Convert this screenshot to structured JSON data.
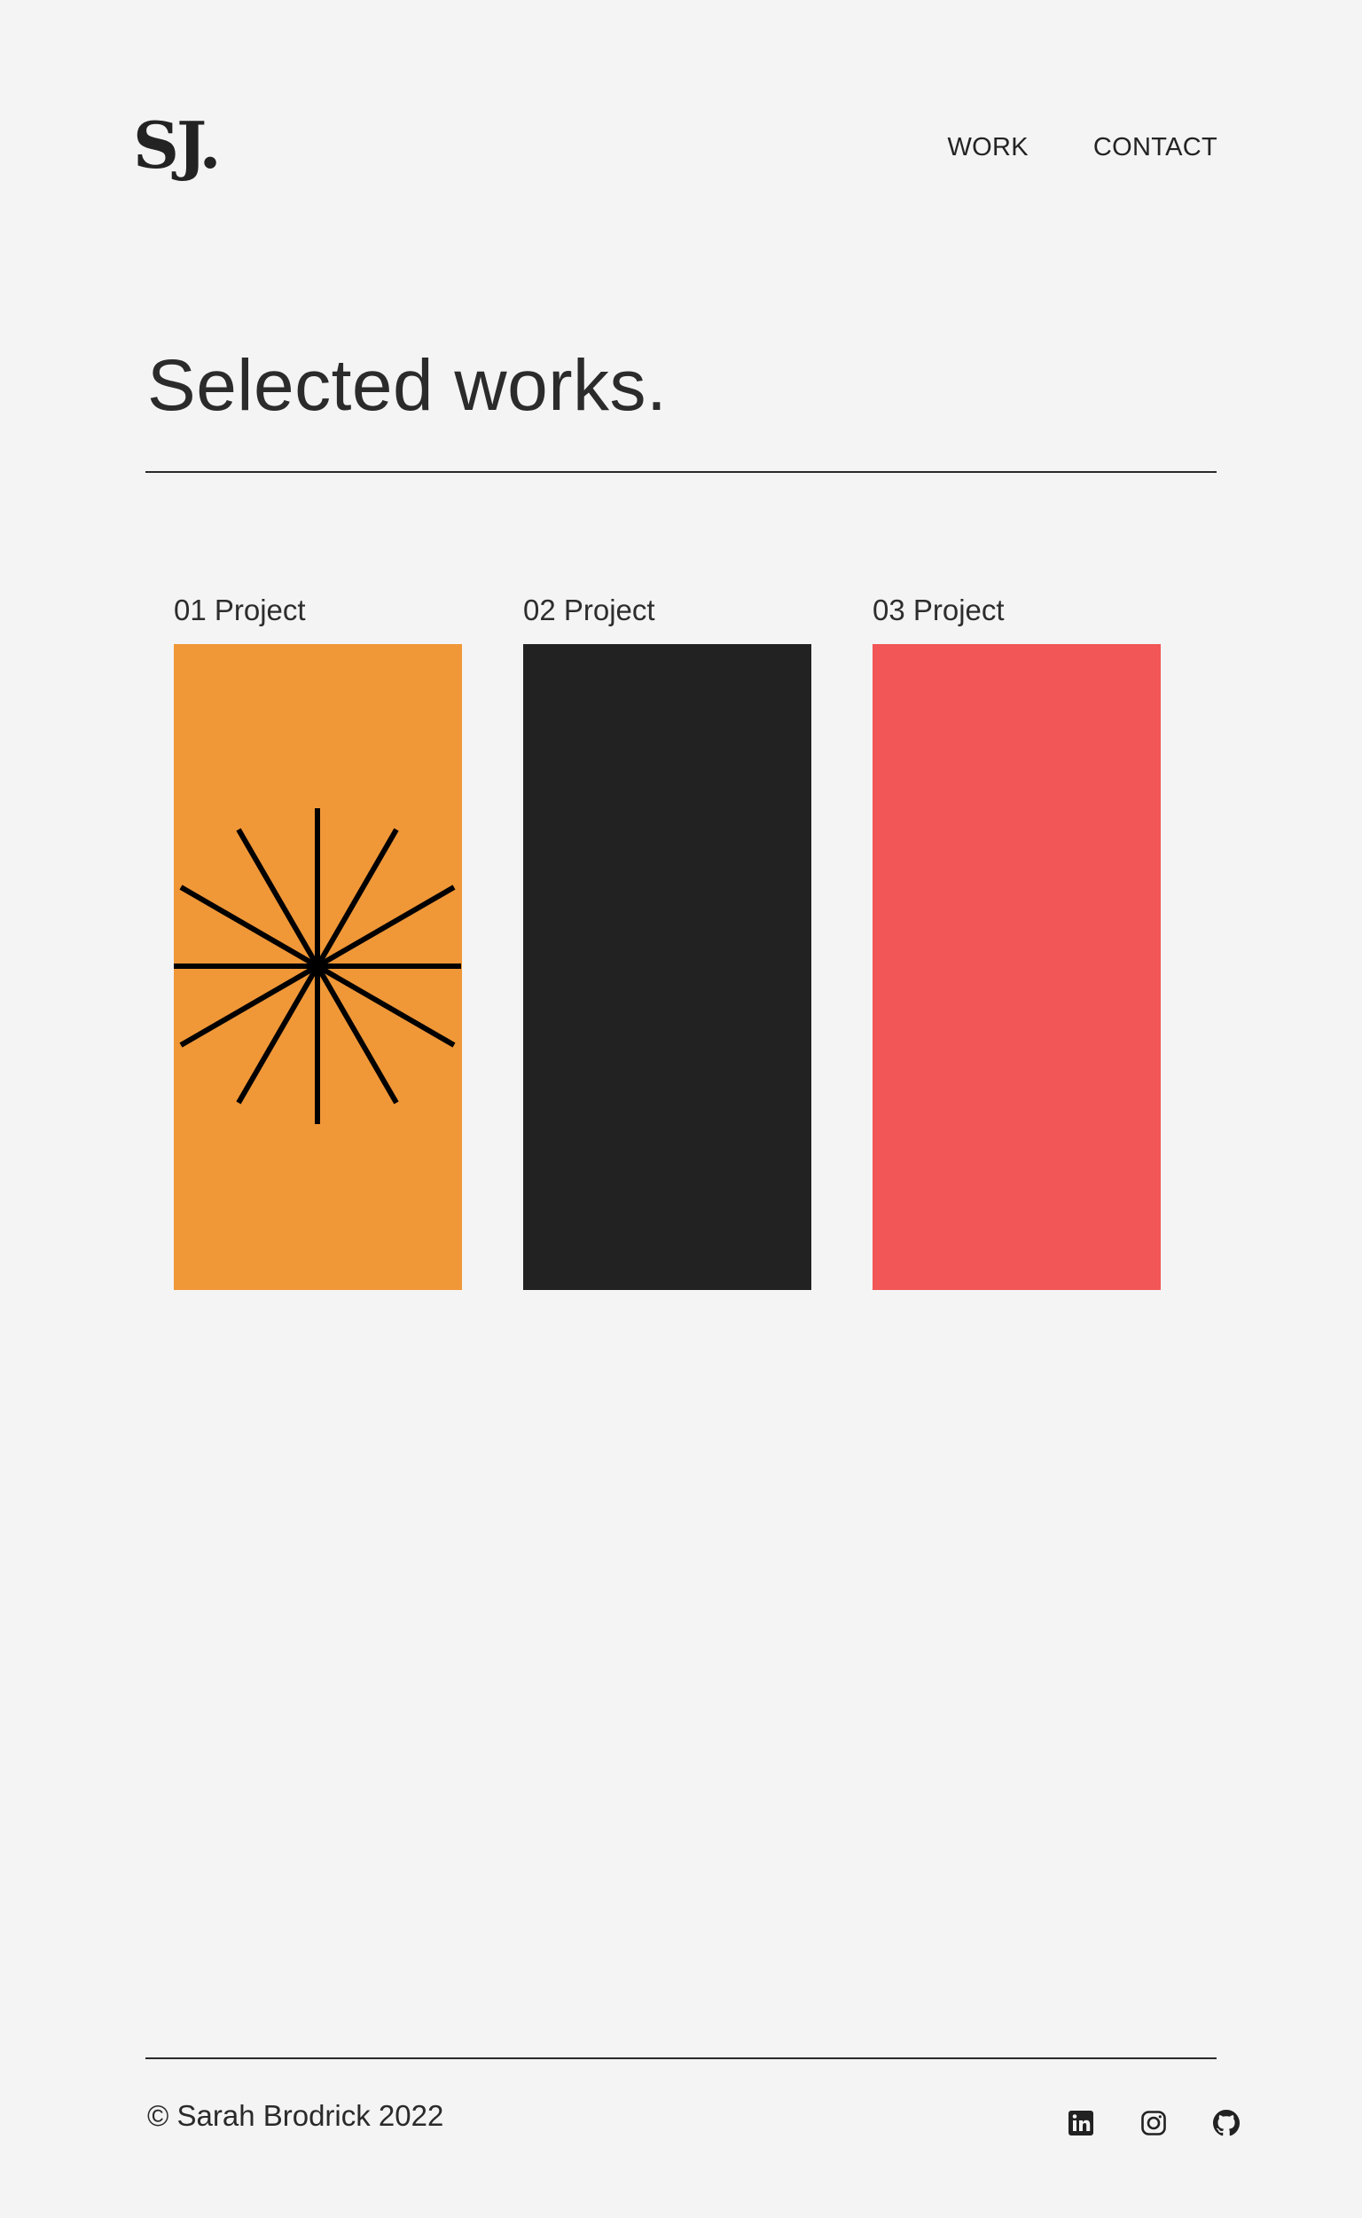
{
  "header": {
    "logo": "SJ.",
    "nav": [
      "WORK",
      "CONTACT"
    ]
  },
  "main": {
    "title": "Selected works.",
    "projects": [
      {
        "label": "01 Project",
        "color": "#f09737",
        "icon": "starburst-icon"
      },
      {
        "label": "02 Project",
        "color": "#222222"
      },
      {
        "label": "03 Project",
        "color": "#f25656"
      }
    ]
  },
  "footer": {
    "copyright": "© Sarah Brodrick 2022",
    "socials": [
      "linkedin-icon",
      "instagram-icon",
      "github-icon"
    ]
  }
}
